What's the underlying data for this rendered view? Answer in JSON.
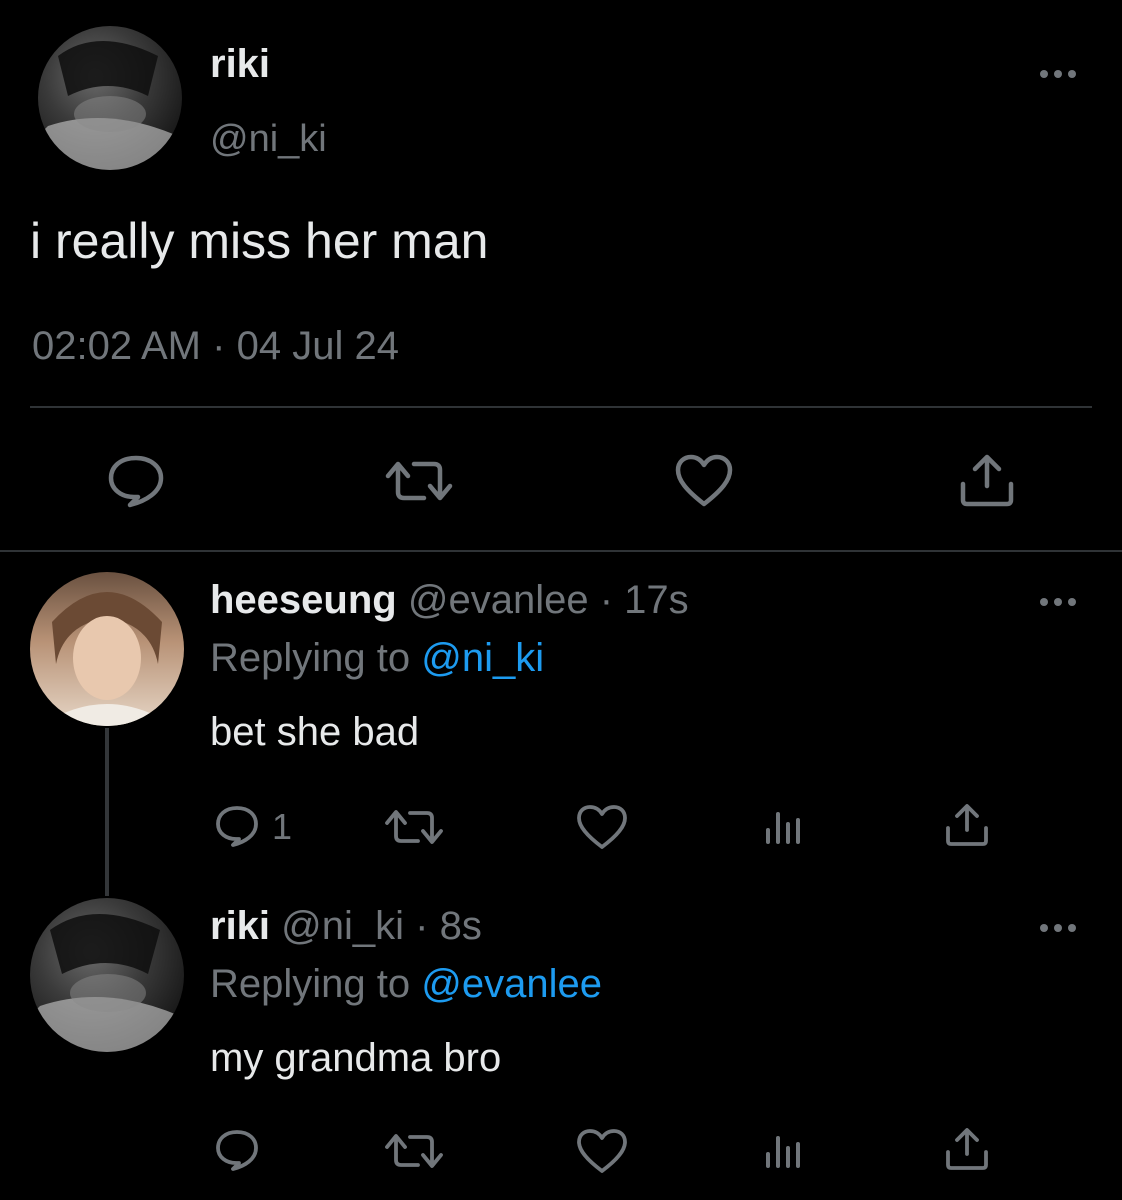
{
  "main_tweet": {
    "display_name": "riki",
    "handle": "@ni_ki",
    "text": "i really miss her man",
    "timestamp": "02:02 AM",
    "separator": "·",
    "date": "04 Jul 24",
    "actions": [
      "reply-icon",
      "retweet-icon",
      "like-icon",
      "share-icon"
    ]
  },
  "replies": [
    {
      "display_name": "heeseung",
      "handle": "@evanlee",
      "dot": "·",
      "time": "17s",
      "replying_prefix": "Replying to",
      "replying_to": "@ni_ki",
      "text": "bet she bad",
      "reply_count": "1",
      "actions": [
        "reply-icon",
        "retweet-icon",
        "like-icon",
        "analytics-icon",
        "share-icon"
      ]
    },
    {
      "display_name": "riki",
      "handle": "@ni_ki",
      "dot": "·",
      "time": "8s",
      "replying_prefix": "Replying to",
      "replying_to": "@evanlee",
      "text": "my grandma bro",
      "actions": [
        "reply-icon",
        "retweet-icon",
        "like-icon",
        "analytics-icon",
        "share-icon"
      ]
    }
  ],
  "colors": {
    "background": "#000000",
    "text": "#e7e9ea",
    "muted": "#71767b",
    "link": "#1d9bf0",
    "divider": "#2f3336"
  }
}
